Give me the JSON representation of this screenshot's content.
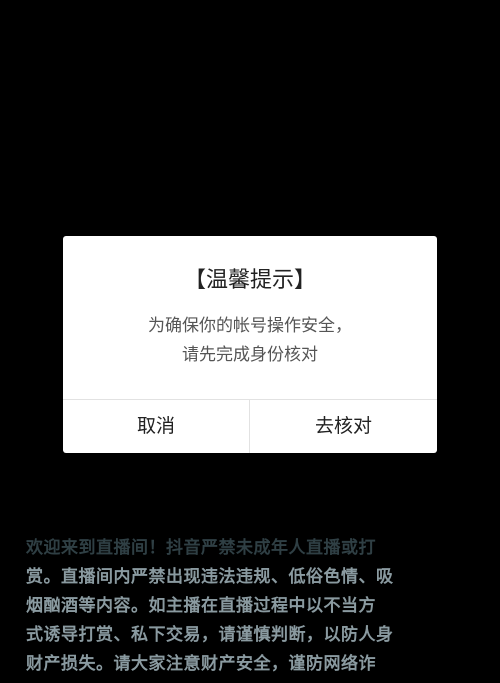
{
  "dialog": {
    "title": "【温馨提示】",
    "message_line1": "为确保你的帐号操作安全，",
    "message_line2": "请先完成身份核对",
    "cancel_label": "取消",
    "confirm_label": "去核对"
  },
  "notice": {
    "lines": [
      "欢迎来到直播间！抖音严禁未成年人直播或打",
      "赏。直播间内严禁出现违法违规、低俗色情、吸",
      "烟酗酒等内容。如主播在直播过程中以不当方",
      "式诱导打赏、私下交易，请谨慎判断，以防人身",
      "财产损失。请大家注意财产安全，谨防网络诈"
    ]
  },
  "colors": {
    "background": "#000000",
    "dialog_background": "#ffffff",
    "notice_text": "#8a9aa0"
  }
}
